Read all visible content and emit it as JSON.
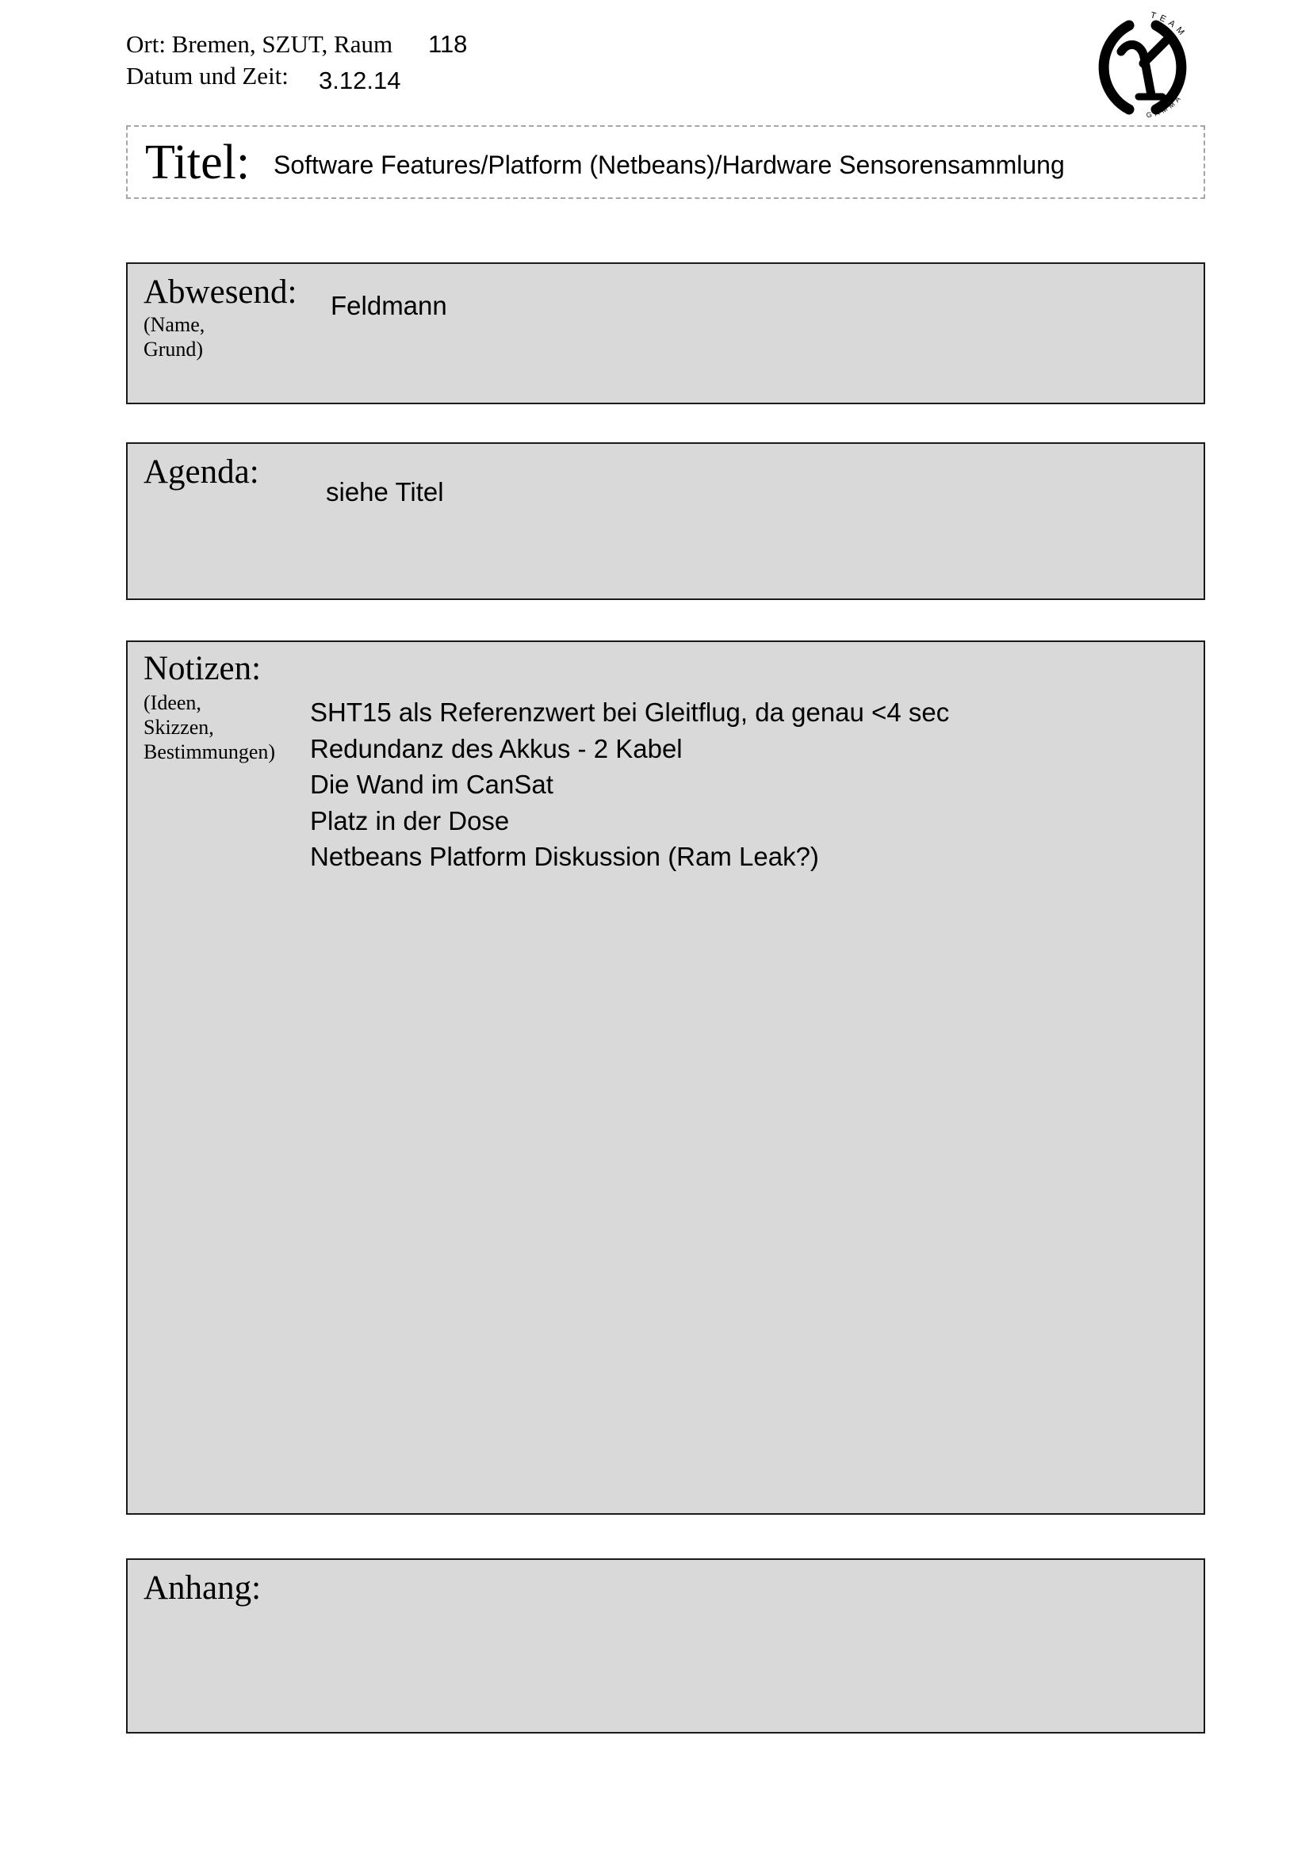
{
  "header": {
    "ort_label": "Ort: Bremen, SZUT, Raum",
    "raum_value": "118",
    "datum_label": "Datum und Zeit:",
    "datum_value": "3.12.14"
  },
  "logo": {
    "top_text": "TEAM",
    "bottom_text": "GAMMA",
    "icon": "gamma-symbol-icon"
  },
  "title": {
    "label": "Titel:",
    "value": "Software Features/Platform (Netbeans)/Hardware Sensorensammlung"
  },
  "abwesend": {
    "label": "Abwesend:",
    "sub_line1": "(Name,",
    "sub_line2": "Grund)",
    "value": "Feldmann"
  },
  "agenda": {
    "label": "Agenda:",
    "value": "siehe Titel"
  },
  "notizen": {
    "label": "Notizen:",
    "sub_line1": "(Ideen,",
    "sub_line2": "Skizzen,",
    "sub_line3": "Bestimmungen)",
    "items": [
      "SHT15 als Referenzwert bei Gleitflug, da genau <4 sec",
      "Redundanz des Akkus - 2 Kabel",
      "Die Wand im CanSat",
      "Platz in der Dose",
      "Netbeans Platform Diskussion (Ram Leak?)"
    ]
  },
  "anhang": {
    "label": "Anhang:"
  }
}
